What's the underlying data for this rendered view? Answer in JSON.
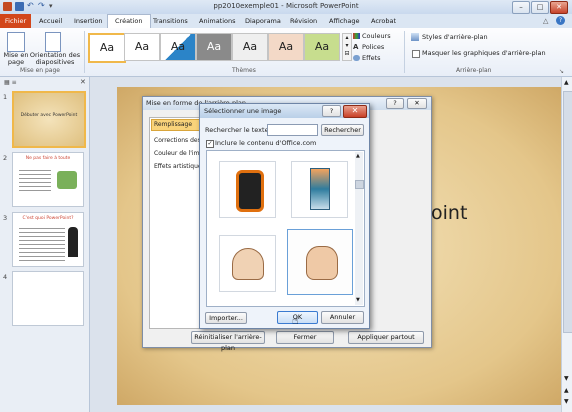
{
  "app": {
    "window_title": "pp2010exemple01 - Microsoft PowerPoint",
    "win_minimize": "–",
    "win_maximize": "□",
    "win_close": "✕",
    "help": "?"
  },
  "tabs": {
    "file": "Fichier",
    "items": [
      "Accueil",
      "Insertion",
      "Création",
      "Transitions",
      "Animations",
      "Diaporama",
      "Révision",
      "Affichage",
      "Acrobat"
    ],
    "active": "Création"
  },
  "ribbon": {
    "page_setup": "Mise en page",
    "orientation": "Orientation des diapositives",
    "group_mise_en_page": "Mise en page",
    "group_themes": "Thèmes",
    "themes_label": "Aa",
    "couleurs": "Couleurs",
    "polices": "Polices",
    "effets": "Effets",
    "styles_arriere_plan": "Styles d'arrière-plan",
    "masquer": "Masquer les graphiques d'arrière-plan",
    "group_arriere_plan": "Arrière-plan",
    "colors": {
      "file_tab": "#d2461a",
      "accent": "#4a7fc1"
    }
  },
  "slides": [
    {
      "num": "1",
      "title": "Débuter avec PowerPoint"
    },
    {
      "num": "2",
      "title": "Ne pas faire à toute"
    },
    {
      "num": "3",
      "title": "C'est quoi PowerPoint?"
    },
    {
      "num": "4",
      "title": ""
    }
  ],
  "slide_text": "oint",
  "format_dialog": {
    "title": "Mise en forme de l'arrière-plan",
    "help": "?",
    "close": "✕",
    "categories": [
      "Remplissage",
      "Corrections des i",
      "Couleur de l'image",
      "Effets artistiques"
    ],
    "reset_button": "Réinitialiser l'arrière-plan",
    "close_button": "Fermer",
    "apply_all_button": "Appliquer partout"
  },
  "select_image_dialog": {
    "title": "Sélectionner une image",
    "help": "?",
    "close": "✕",
    "search_label": "Rechercher le texte :",
    "search_value": "",
    "search_button": "Rechercher",
    "include_office": "Inclure le contenu d'Office.com",
    "include_checked": true,
    "import_button": "Importer...",
    "ok_button": "OK",
    "cancel_button": "Annuler"
  }
}
